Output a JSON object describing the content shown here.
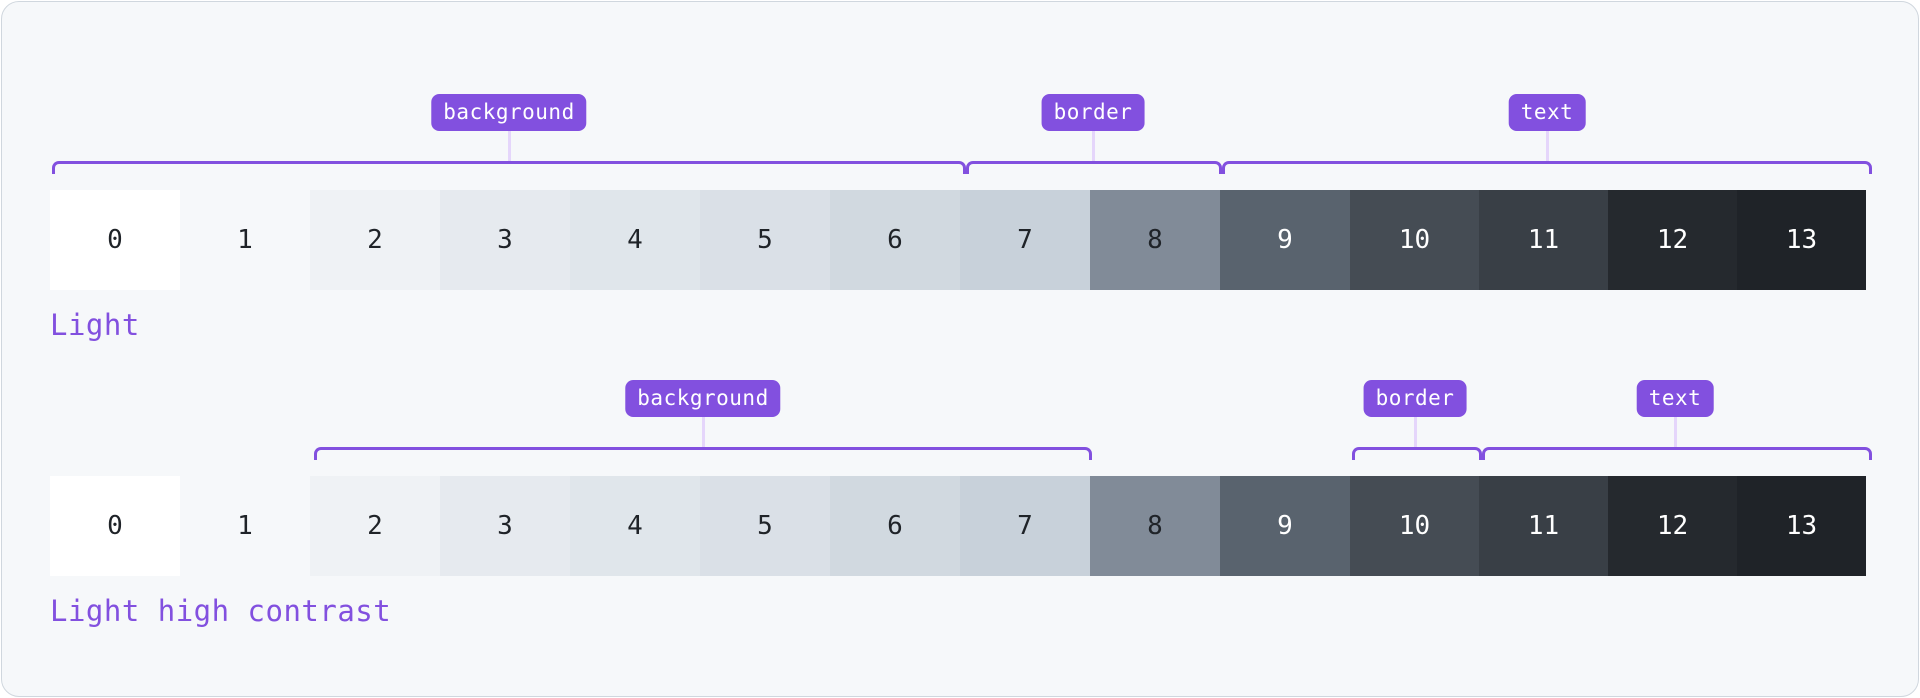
{
  "accent_color": "#8250df",
  "stem_color": "#e5d6fb",
  "scales": [
    {
      "name": "Light",
      "groups": [
        {
          "label": "background",
          "from": 0,
          "to": 7
        },
        {
          "label": "border",
          "from": 7,
          "to": 8
        },
        {
          "label": "text",
          "from": 9,
          "to": 13
        }
      ],
      "swatches": [
        {
          "label": "0",
          "bg": "#ffffff",
          "fg": "#1f2328"
        },
        {
          "label": "1",
          "bg": "#f6f8fa",
          "fg": "#1f2328"
        },
        {
          "label": "2",
          "bg": "#eff2f5",
          "fg": "#1f2328"
        },
        {
          "label": "3",
          "bg": "#e6eaef",
          "fg": "#1f2328"
        },
        {
          "label": "4",
          "bg": "#e0e6eb",
          "fg": "#1f2328"
        },
        {
          "label": "5",
          "bg": "#dae0e7",
          "fg": "#1f2328"
        },
        {
          "label": "6",
          "bg": "#d1d9e0",
          "fg": "#1f2328"
        },
        {
          "label": "7",
          "bg": "#c8d1da",
          "fg": "#1f2328"
        },
        {
          "label": "8",
          "bg": "#818b98",
          "fg": "#1f2328"
        },
        {
          "label": "9",
          "bg": "#59636e",
          "fg": "#ffffff"
        },
        {
          "label": "10",
          "bg": "#454c54",
          "fg": "#ffffff"
        },
        {
          "label": "11",
          "bg": "#393f46",
          "fg": "#ffffff"
        },
        {
          "label": "12",
          "bg": "#25292e",
          "fg": "#ffffff"
        },
        {
          "label": "13",
          "bg": "#1f2328",
          "fg": "#ffffff"
        }
      ]
    },
    {
      "name": "Light high contrast",
      "groups": [
        {
          "label": "background",
          "from": 2,
          "to": 7
        },
        {
          "label": "border",
          "from": 10,
          "to": 10
        },
        {
          "label": "text",
          "from": 11,
          "to": 13
        }
      ],
      "swatches": [
        {
          "label": "0",
          "bg": "#ffffff",
          "fg": "#1f2328"
        },
        {
          "label": "1",
          "bg": "#f6f8fa",
          "fg": "#1f2328"
        },
        {
          "label": "2",
          "bg": "#eff2f5",
          "fg": "#1f2328"
        },
        {
          "label": "3",
          "bg": "#e6eaef",
          "fg": "#1f2328"
        },
        {
          "label": "4",
          "bg": "#e0e6eb",
          "fg": "#1f2328"
        },
        {
          "label": "5",
          "bg": "#dae0e7",
          "fg": "#1f2328"
        },
        {
          "label": "6",
          "bg": "#d1d9e0",
          "fg": "#1f2328"
        },
        {
          "label": "7",
          "bg": "#c8d1da",
          "fg": "#1f2328"
        },
        {
          "label": "8",
          "bg": "#818b98",
          "fg": "#1f2328"
        },
        {
          "label": "9",
          "bg": "#59636e",
          "fg": "#ffffff"
        },
        {
          "label": "10",
          "bg": "#454c54",
          "fg": "#ffffff"
        },
        {
          "label": "11",
          "bg": "#393f46",
          "fg": "#ffffff"
        },
        {
          "label": "12",
          "bg": "#25292e",
          "fg": "#ffffff"
        },
        {
          "label": "13",
          "bg": "#1f2328",
          "fg": "#ffffff"
        }
      ]
    }
  ]
}
